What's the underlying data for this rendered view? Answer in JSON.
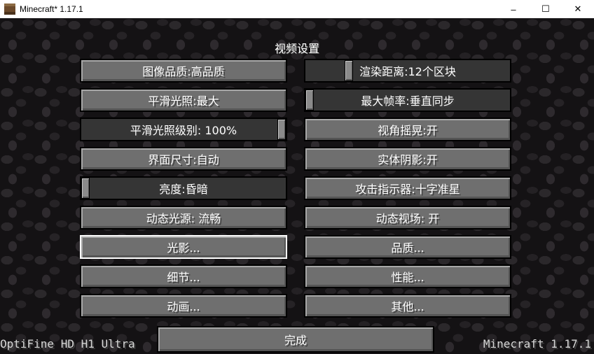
{
  "window": {
    "title": "Minecraft* 1.17.1",
    "minimize": "–",
    "maximize": "☐",
    "close": "✕"
  },
  "screen": {
    "title": "视频设置"
  },
  "left_column": [
    {
      "label": "图像品质:高品质",
      "kind": "button"
    },
    {
      "label": "平滑光照:最大",
      "kind": "button"
    },
    {
      "label": "平滑光照级别: 100%",
      "kind": "slider",
      "value": 1.0
    },
    {
      "label": "界面尺寸:自动",
      "kind": "button"
    },
    {
      "label": "亮度:昏暗",
      "kind": "slider",
      "value": 0.0
    },
    {
      "label": "动态光源: 流畅",
      "kind": "button"
    },
    {
      "label": "光影...",
      "kind": "button",
      "focused": true
    },
    {
      "label": "细节...",
      "kind": "button"
    },
    {
      "label": "动画...",
      "kind": "button"
    }
  ],
  "right_column": [
    {
      "label": "渲染距离:12个区块",
      "kind": "slider",
      "value": 0.2
    },
    {
      "label": "最大帧率:垂直同步",
      "kind": "slider",
      "value": 0.0
    },
    {
      "label": "视角摇晃:开",
      "kind": "button"
    },
    {
      "label": "实体阴影:开",
      "kind": "button"
    },
    {
      "label": "攻击指示器:十字准星",
      "kind": "button"
    },
    {
      "label": "动态视场: 开",
      "kind": "button"
    },
    {
      "label": "品质...",
      "kind": "button"
    },
    {
      "label": "性能...",
      "kind": "button"
    },
    {
      "label": "其他...",
      "kind": "button"
    }
  ],
  "done_button": "完成",
  "footer": {
    "left": "OptiFine HD H1 Ultra",
    "right": "Minecraft 1.17.1"
  }
}
